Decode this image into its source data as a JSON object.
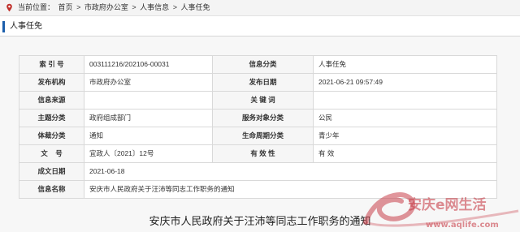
{
  "breadcrumb": {
    "prefix": "当前位置：",
    "items": [
      "首页",
      "市政府办公室",
      "人事信息",
      "人事任免"
    ],
    "separator": ">"
  },
  "section": {
    "title": "人事任免"
  },
  "info": {
    "rows": [
      {
        "label1": "索 引 号",
        "value1": "003111216/202106-00031",
        "label2": "信息分类",
        "value2": "人事任免"
      },
      {
        "label1": "发布机构",
        "value1": "市政府办公室",
        "label2": "发布日期",
        "value2": "2021-06-21 09:57:49"
      },
      {
        "label1": "信息来源",
        "value1": "",
        "label2": "关 键 词",
        "value2": ""
      },
      {
        "label1": "主题分类",
        "value1": "政府组成部门",
        "label2": "服务对象分类",
        "value2": "公民"
      },
      {
        "label1": "体裁分类",
        "value1": "通知",
        "label2": "生命周期分类",
        "value2": "青少年"
      },
      {
        "label1": "文    号",
        "value1": "宜政人〔2021〕12号",
        "label2": "有 效 性",
        "value2": "有 效"
      }
    ],
    "date_label": "成文日期",
    "date_value": "2021-06-18",
    "name_label": "信息名称",
    "name_value": "安庆市人民政府关于汪沛等同志工作职务的通知"
  },
  "document": {
    "title": "安庆市人民政府关于汪沛等同志工作职务的通知"
  },
  "watermark": {
    "text": "安庆e网生活",
    "url": "www.aqlife.com"
  }
}
